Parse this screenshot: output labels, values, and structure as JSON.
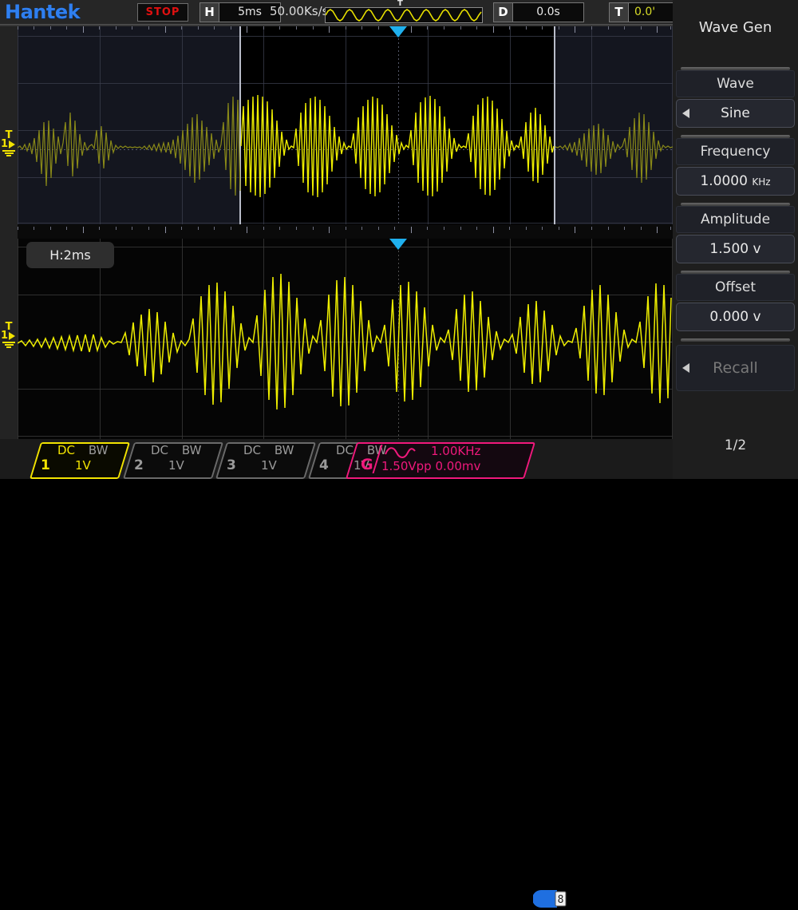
{
  "brand": "Hantek",
  "topbar": {
    "run_status": "STOP",
    "horizontal_key": "H",
    "horizontal_value": "5ms",
    "sample_rate": "50.00Ks/s",
    "overview_trigger_marker": "T",
    "delay_key": "D",
    "delay_value": "0.0s",
    "trigger_key": "T",
    "trigger_value": "0.0'"
  },
  "display": {
    "zoom_label": "H:2ms",
    "channel_marker_top": {
      "trigger": "T",
      "channel": "1"
    },
    "channel_marker_bottom": {
      "trigger": "T",
      "channel": "1"
    }
  },
  "sidebar": {
    "title": "Wave Gen",
    "groups": [
      {
        "label": "Wave",
        "value": "Sine",
        "unit": "",
        "has_caret": true
      },
      {
        "label": "Frequency",
        "value": "1.0000",
        "unit": "KHz",
        "has_caret": false
      },
      {
        "label": "Amplitude",
        "value": "1.500",
        "unit": "v",
        "has_caret": false
      },
      {
        "label": "Offset",
        "value": "0.000",
        "unit": "v",
        "has_caret": false
      }
    ],
    "recall_label": "Recall",
    "page_indicator": "1/2"
  },
  "channels": [
    {
      "num": "1",
      "coupling": "DC",
      "bandwidth": "BW",
      "scale": "1V",
      "active": true
    },
    {
      "num": "2",
      "coupling": "DC",
      "bandwidth": "BW",
      "scale": "1V",
      "active": false
    },
    {
      "num": "3",
      "coupling": "DC",
      "bandwidth": "BW",
      "scale": "1V",
      "active": false
    },
    {
      "num": "4",
      "coupling": "DC",
      "bandwidth": "BW",
      "scale": "1V",
      "active": false
    }
  ],
  "generator_status": {
    "tag": "G",
    "frequency": "1.00KHz",
    "amplitude_offset": "1.50Vpp 0.00mv",
    "wave_icon": "sine-icon"
  },
  "storage_badge": "8",
  "colors": {
    "brand_blue": "#2f7ff0",
    "stop_red": "#e01010",
    "channel1_yellow": "#f2e300",
    "generator_magenta": "#f0197c",
    "trigger_cyan": "#1fb0ee",
    "grid": "#3b3f4d"
  }
}
